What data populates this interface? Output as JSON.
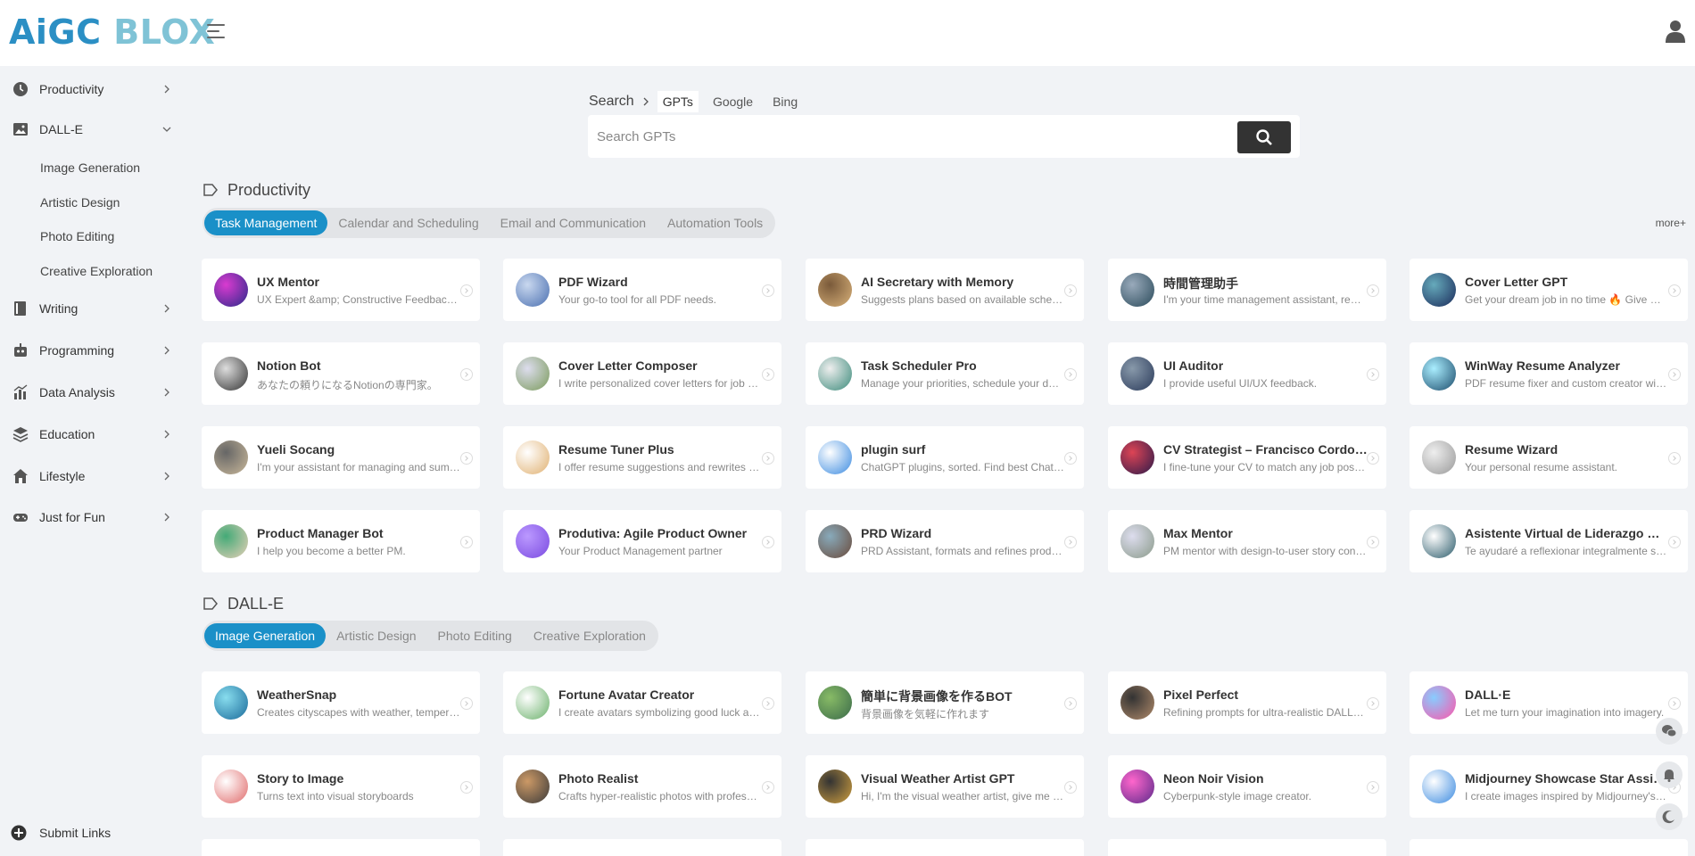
{
  "logo": {
    "part1": "AiGC",
    "part2": "BLOX"
  },
  "sidebar": {
    "items": [
      {
        "label": "Productivity",
        "icon": "clock-icon"
      },
      {
        "label": "DALL-E",
        "icon": "image-icon"
      },
      {
        "label": "Writing",
        "icon": "book-icon"
      },
      {
        "label": "Programming",
        "icon": "robot-icon"
      },
      {
        "label": "Data Analysis",
        "icon": "chart-icon"
      },
      {
        "label": "Education",
        "icon": "layers-icon"
      },
      {
        "label": "Lifestyle",
        "icon": "home-icon"
      },
      {
        "label": "Just for Fun",
        "icon": "gamepad-icon"
      }
    ],
    "dalle_sub": [
      "Image Generation",
      "Artistic Design",
      "Photo Editing",
      "Creative Exploration"
    ],
    "submit": "Submit Links"
  },
  "search": {
    "label": "Search",
    "tabs": [
      "GPTs",
      "Google",
      "Bing"
    ],
    "placeholder": "Search GPTs"
  },
  "productivity": {
    "title": "Productivity",
    "tabs": [
      "Task Management",
      "Calendar and Scheduling",
      "Email and Communication",
      "Automation Tools"
    ],
    "more": "more+",
    "cards": [
      {
        "title": "UX Mentor",
        "desc": "UX Expert &amp; Constructive Feedback Specialist"
      },
      {
        "title": "PDF Wizard",
        "desc": "Your go-to tool for all PDF needs."
      },
      {
        "title": "AI Secretary with Memory",
        "desc": "Suggests plans based on available schedule"
      },
      {
        "title": "時間管理助手",
        "desc": "I'm your time management assistant, ready to help"
      },
      {
        "title": "Cover Letter GPT",
        "desc": "Get your dream job in no time 🔥 Give me your resume"
      },
      {
        "title": "Notion Bot",
        "desc": "あなたの頼りになるNotionの専門家。"
      },
      {
        "title": "Cover Letter Composer",
        "desc": "I write personalized cover letters for job applications"
      },
      {
        "title": "Task Scheduler Pro",
        "desc": "Manage your priorities, schedule your days"
      },
      {
        "title": "UI Auditor",
        "desc": "I provide useful UI/UX feedback."
      },
      {
        "title": "WinWay Resume Analyzer",
        "desc": "PDF resume fixer and custom creator with AI"
      },
      {
        "title": "Yueli Socang",
        "desc": "I'm your assistant for managing and summarizing"
      },
      {
        "title": "Resume Tuner Plus",
        "desc": "I offer resume suggestions and rewrites for jobs"
      },
      {
        "title": "plugin surf",
        "desc": "ChatGPT plugins, sorted. Find best ChatGPT plugins"
      },
      {
        "title": "CV Strategist – Francisco Cordoba",
        "desc": "I fine-tune your CV to match any job position"
      },
      {
        "title": "Resume Wizard",
        "desc": "Your personal resume assistant."
      },
      {
        "title": "Product Manager Bot",
        "desc": "I help you become a better PM."
      },
      {
        "title": "Produtiva: Agile Product Owner",
        "desc": "Your Product Management partner"
      },
      {
        "title": "PRD Wizard",
        "desc": "PRD Assistant, formats and refines product docs"
      },
      {
        "title": "Max Mentor",
        "desc": "PM mentor with design-to-user story conversion"
      },
      {
        "title": "Asistente Virtual de Liderazgo Mentor",
        "desc": "Te ayudaré a reflexionar integralmente sobre tu liderazgo"
      }
    ]
  },
  "dalle": {
    "title": "DALL-E",
    "tabs": [
      "Image Generation",
      "Artistic Design",
      "Photo Editing",
      "Creative Exploration"
    ],
    "cards": [
      {
        "title": "WeatherSnap",
        "desc": "Creates cityscapes with weather, temperature and date"
      },
      {
        "title": "Fortune Avatar Creator",
        "desc": "I create avatars symbolizing good luck and fortune"
      },
      {
        "title": "簡単に背景画像を作るBOT",
        "desc": "背景画像を気軽に作れます"
      },
      {
        "title": "Pixel Perfect",
        "desc": "Refining prompts for ultra-realistic DALL-E images"
      },
      {
        "title": "DALL·E",
        "desc": "Let me turn your imagination into imagery."
      },
      {
        "title": "Story to Image",
        "desc": "Turns text into visual storyboards"
      },
      {
        "title": "Photo Realist",
        "desc": "Crafts hyper-realistic photos with professional detail"
      },
      {
        "title": "Visual Weather Artist GPT",
        "desc": "Hi, I'm the visual weather artist, give me your city"
      },
      {
        "title": "Neon Noir Vision",
        "desc": "Cyberpunk-style image creator."
      },
      {
        "title": "Midjourney Showcase Star Assistant",
        "desc": "I create images inspired by Midjourney's showcase"
      }
    ]
  },
  "colors": {
    "accent": "#1a90c8",
    "logo_dark": "#2b8fc4",
    "logo_light": "#7fc3d6"
  }
}
